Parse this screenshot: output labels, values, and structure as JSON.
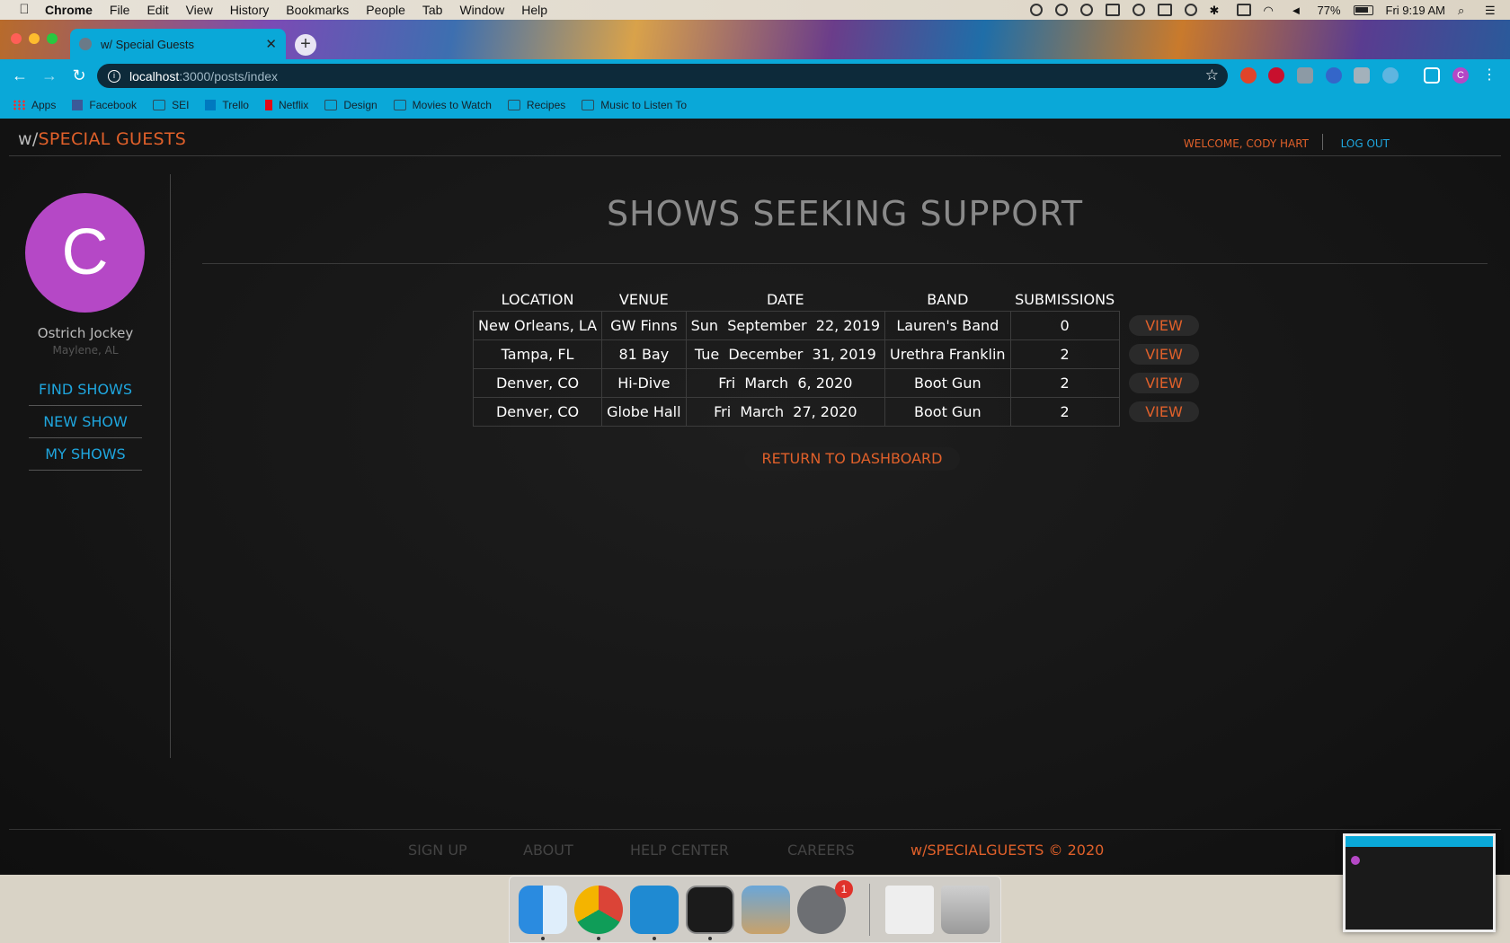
{
  "menubar": {
    "app": "Chrome",
    "items": [
      "File",
      "Edit",
      "View",
      "History",
      "Bookmarks",
      "People",
      "Tab",
      "Window",
      "Help"
    ],
    "battery": "77%",
    "clock": "Fri 9:19 AM"
  },
  "browser": {
    "tab_title": "w/ Special Guests",
    "url_host": "localhost",
    "url_path": ":3000/posts/index",
    "bookmarks": [
      "Apps",
      "Facebook",
      "SEI",
      "Trello",
      "Netflix",
      "Design",
      "Movies to Watch",
      "Recipes",
      "Music to Listen To"
    ]
  },
  "site": {
    "brand_prefix": "w/",
    "brand_accent": "SPECIAL GUESTS",
    "welcome": "WELCOME, CODY HART",
    "logout": "LOG OUT"
  },
  "sidebar": {
    "avatar_letter": "C",
    "name": "Ostrich Jockey",
    "location": "Maylene, AL",
    "links": [
      "FIND SHOWS",
      "NEW SHOW",
      "MY SHOWS"
    ]
  },
  "main": {
    "title": "SHOWS SEEKING SUPPORT",
    "columns": [
      "LOCATION",
      "VENUE",
      "DATE",
      "BAND",
      "SUBMISSIONS"
    ],
    "rows": [
      {
        "location": "New Orleans, LA",
        "venue": "GW Finns",
        "date": "Sun  September  22, 2019",
        "band": "Lauren's Band",
        "submissions": "0",
        "action": "VIEW"
      },
      {
        "location": "Tampa, FL",
        "venue": "81 Bay",
        "date": "Tue  December  31, 2019",
        "band": "Urethra Franklin",
        "submissions": "2",
        "action": "VIEW"
      },
      {
        "location": "Denver, CO",
        "venue": "Hi-Dive",
        "date": "Fri  March  6, 2020",
        "band": "Boot Gun",
        "submissions": "2",
        "action": "VIEW"
      },
      {
        "location": "Denver, CO",
        "venue": "Globe Hall",
        "date": "Fri  March  27, 2020",
        "band": "Boot Gun",
        "submissions": "2",
        "action": "VIEW"
      }
    ],
    "return_label": "RETURN TO DASHBOARD"
  },
  "footer": {
    "links": [
      "SIGN UP",
      "ABOUT",
      "HELP CENTER",
      "CAREERS"
    ],
    "copyright": "w/SPECIALGUESTS © 2020"
  },
  "dock": {
    "badge": "1"
  },
  "colors": {
    "accent_orange": "#e0602a",
    "link_blue": "#1fa6de",
    "avatar_purple": "#b548c6",
    "chrome_cyan": "#0aa8d8"
  }
}
